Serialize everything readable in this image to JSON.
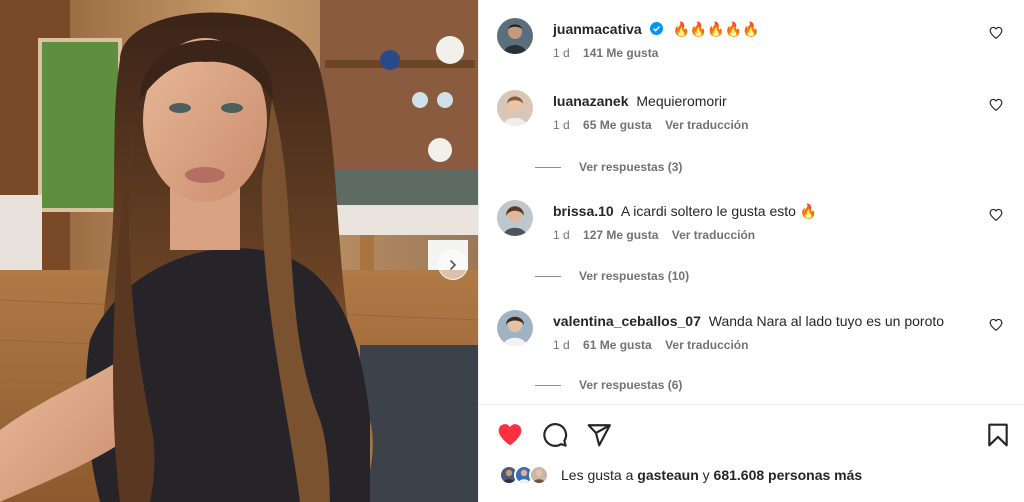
{
  "post": {
    "carousel_next_icon": "chevron-right-icon"
  },
  "comments": [
    {
      "username": "juanmacativa",
      "verified": true,
      "text": "🔥🔥🔥🔥🔥",
      "time": "1 d",
      "likes": "141 Me gusta",
      "translate": "",
      "replies": ""
    },
    {
      "username": "luanazanek",
      "verified": false,
      "text": "Mequieromorir",
      "time": "1 d",
      "likes": "65 Me gusta",
      "translate": "Ver traducción",
      "replies": "Ver respuestas (3)"
    },
    {
      "username": "brissa.10",
      "verified": false,
      "text": "A icardi soltero le gusta esto 🔥",
      "time": "1 d",
      "likes": "127 Me gusta",
      "translate": "Ver traducción",
      "replies": "Ver respuestas (10)"
    },
    {
      "username": "valentina_ceballos_07",
      "verified": false,
      "text": "Wanda Nara al lado tuyo es un poroto",
      "time": "1 d",
      "likes": "61 Me gusta",
      "translate": "Ver traducción",
      "replies": "Ver respuestas (6)"
    }
  ],
  "actions": {
    "like_icon": "heart-filled-icon",
    "comment_icon": "comment-icon",
    "share_icon": "send-icon",
    "save_icon": "bookmark-icon",
    "like_color": "#ff3040"
  },
  "likes_summary": {
    "prefix": "Les gusta a",
    "user": "gasteaun",
    "connector": "y",
    "count": "681.608 personas más"
  },
  "colors": {
    "text": "#262626",
    "secondary": "#737373",
    "verified": "#0095f6"
  }
}
